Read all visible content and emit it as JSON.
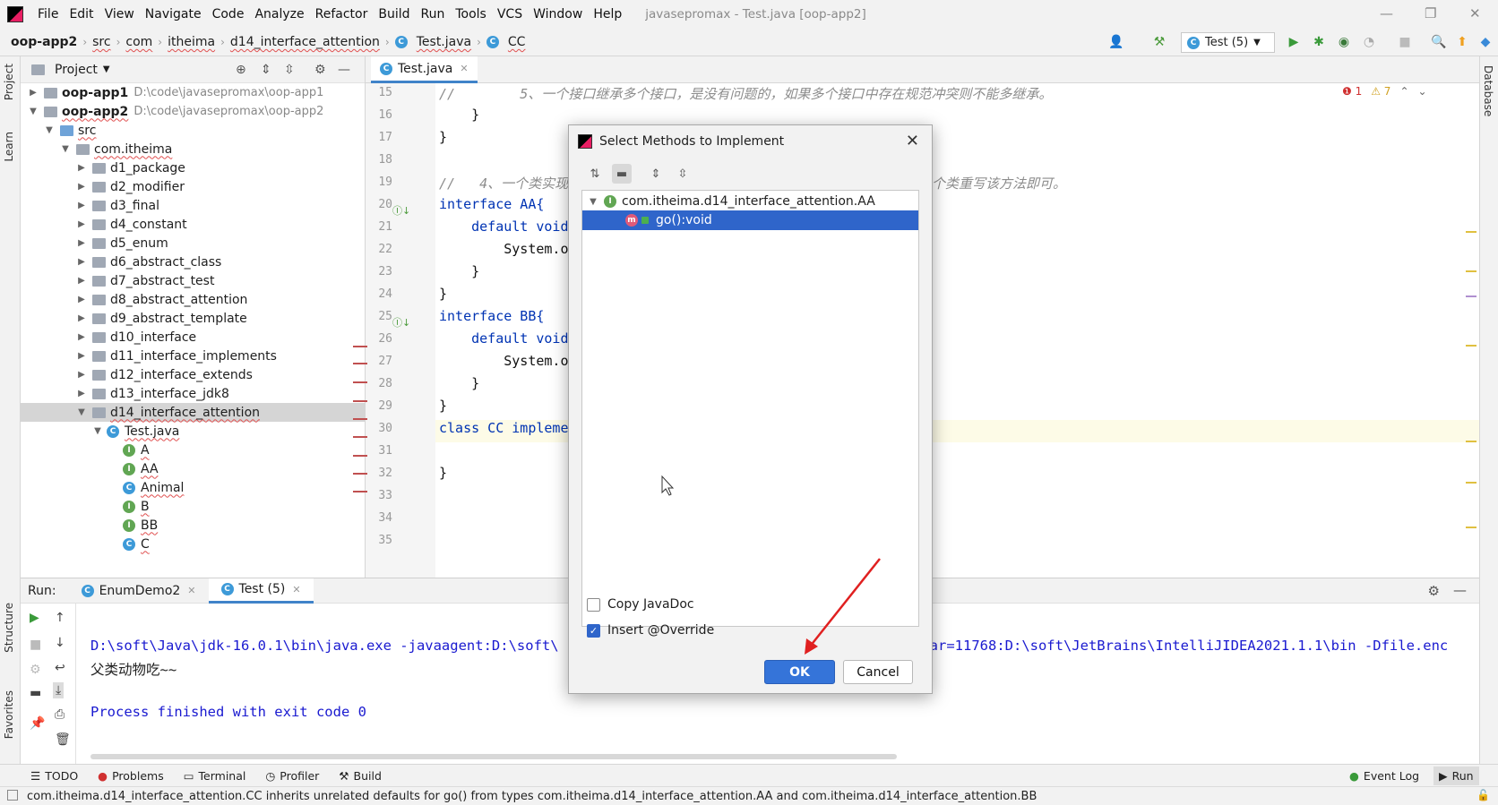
{
  "menu": {
    "items": [
      "File",
      "Edit",
      "View",
      "Navigate",
      "Code",
      "Analyze",
      "Refactor",
      "Build",
      "Run",
      "Tools",
      "VCS",
      "Window",
      "Help"
    ],
    "window_title": "javasepromax - Test.java [oop-app2]"
  },
  "breadcrumb": [
    "oop-app2",
    "src",
    "com",
    "itheima",
    "d14_interface_attention",
    "Test.java",
    "CC"
  ],
  "toolbar": {
    "run_config": "Test (5)"
  },
  "side_tabs": {
    "project": "Project",
    "learn": "Learn",
    "structure": "Structure",
    "favorites": "Favorites",
    "database": "Database"
  },
  "project": {
    "title": "Project",
    "tree": [
      {
        "label": "oop-app1",
        "path": "D:\\code\\javasepromax\\oop-app1"
      },
      {
        "label": "oop-app2",
        "path": "D:\\code\\javasepromax\\oop-app2"
      },
      {
        "label": "src"
      },
      {
        "label": "com.itheima"
      },
      {
        "label": "d1_package"
      },
      {
        "label": "d2_modifier"
      },
      {
        "label": "d3_final"
      },
      {
        "label": "d4_constant"
      },
      {
        "label": "d5_enum"
      },
      {
        "label": "d6_abstract_class"
      },
      {
        "label": "d7_abstract_test"
      },
      {
        "label": "d8_abstract_attention"
      },
      {
        "label": "d9_abstract_template"
      },
      {
        "label": "d10_interface"
      },
      {
        "label": "d11_interface_implements"
      },
      {
        "label": "d12_interface_extends"
      },
      {
        "label": "d13_interface_jdk8"
      },
      {
        "label": "d14_interface_attention"
      },
      {
        "label": "Test.java"
      },
      {
        "label": "A",
        "badge": "I"
      },
      {
        "label": "AA",
        "badge": "I"
      },
      {
        "label": "Animal",
        "badge": "C"
      },
      {
        "label": "B",
        "badge": "I"
      },
      {
        "label": "BB",
        "badge": "I"
      },
      {
        "label": "C",
        "badge": "C"
      }
    ]
  },
  "editor": {
    "tab": "Test.java",
    "inspections": {
      "errors": "1",
      "warnings": "7"
    },
    "lines": [
      {
        "n": "15",
        "text": "//        5、一个接口继承多个接口，是没有问题的，如果多个接口中存在规范冲突则不能多继承。"
      },
      {
        "n": "16",
        "text": "    }"
      },
      {
        "n": "17",
        "text": "}"
      },
      {
        "n": "18",
        "text": ""
      },
      {
        "n": "19",
        "text": "//   4、一个类实现"
      },
      {
        "n": "20",
        "text": "interface AA{"
      },
      {
        "n": "21",
        "text": "    default void"
      },
      {
        "n": "22",
        "text": "        System.o"
      },
      {
        "n": "23",
        "text": "    }"
      },
      {
        "n": "24",
        "text": "}"
      },
      {
        "n": "25",
        "text": "interface BB{"
      },
      {
        "n": "26",
        "text": "    default void"
      },
      {
        "n": "27",
        "text": "        System.o"
      },
      {
        "n": "28",
        "text": "    }"
      },
      {
        "n": "29",
        "text": "}"
      },
      {
        "n": "30",
        "text": "class CC impleme"
      },
      {
        "n": "31",
        "text": ""
      },
      {
        "n": "32",
        "text": "}"
      },
      {
        "n": "33",
        "text": ""
      },
      {
        "n": "34",
        "text": ""
      },
      {
        "n": "35",
        "text": ""
      }
    ],
    "right_comment": "个类重写该方法即可。"
  },
  "run": {
    "label": "Run:",
    "tabs": [
      "EnumDemo2",
      "Test (5)"
    ],
    "console": [
      "D:\\soft\\Java\\jdk-16.0.1\\bin\\java.exe -javaagent:D:\\soft\\",
      "父类动物吃~~",
      "",
      "Process finished with exit code 0"
    ],
    "console_right": ".jar=11768:D:\\soft\\JetBrains\\IntelliJIDEA2021.1.1\\bin -Dfile.enc"
  },
  "bottom_tabs": [
    "TODO",
    "Problems",
    "Terminal",
    "Profiler",
    "Build"
  ],
  "bottom_right": [
    "Event Log",
    "Run"
  ],
  "status": "com.itheima.d14_interface_attention.CC inherits unrelated defaults for go() from types com.itheima.d14_interface_attention.AA and com.itheima.d14_interface_attention.BB",
  "dialog": {
    "title": "Select Methods to Implement",
    "tree": {
      "root": "com.itheima.d14_interface_attention.AA",
      "root_badge": "I",
      "method": "go():void",
      "method_badge": "m"
    },
    "copy_javadoc": "Copy JavaDoc",
    "insert_override": "Insert @Override",
    "ok": "OK",
    "cancel": "Cancel"
  },
  "colors": {
    "accent": "#2f65ca",
    "keyword": "#0033b3",
    "error": "#e05050"
  }
}
